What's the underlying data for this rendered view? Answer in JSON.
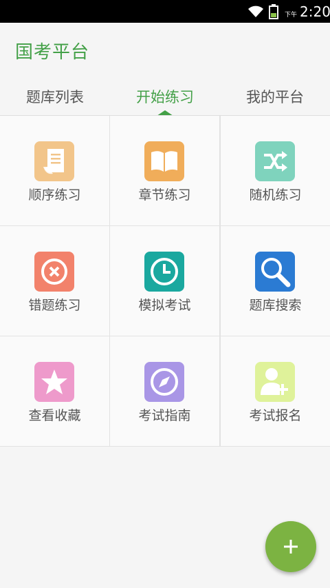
{
  "status_bar": {
    "ampm": "下午",
    "time": "2:20"
  },
  "app": {
    "title": "国考平台"
  },
  "tabs": [
    {
      "label": "题库列表",
      "active": false
    },
    {
      "label": "开始练习",
      "active": true
    },
    {
      "label": "我的平台",
      "active": false
    }
  ],
  "grid": {
    "items": [
      {
        "label": "顺序练习",
        "icon": "document-list-icon",
        "color": "#f2c58a"
      },
      {
        "label": "章节练习",
        "icon": "open-book-icon",
        "color": "#f0ad5a"
      },
      {
        "label": "随机练习",
        "icon": "shuffle-icon",
        "color": "#7fd3bd"
      },
      {
        "label": "错题练习",
        "icon": "close-circle-icon",
        "color": "#f2826b"
      },
      {
        "label": "模拟考试",
        "icon": "clock-icon",
        "color": "#1aa89f"
      },
      {
        "label": "题库搜索",
        "icon": "search-icon",
        "color": "#2b7bd3"
      },
      {
        "label": "查看收藏",
        "icon": "star-icon",
        "color": "#ee9acb"
      },
      {
        "label": "考试指南",
        "icon": "compass-icon",
        "color": "#a996e6"
      },
      {
        "label": "考试报名",
        "icon": "add-user-icon",
        "color": "#dff29a"
      }
    ]
  },
  "fab": {
    "icon": "plus-icon",
    "label": "+"
  },
  "colors": {
    "accent": "#43a047",
    "fab": "#7cb342"
  }
}
